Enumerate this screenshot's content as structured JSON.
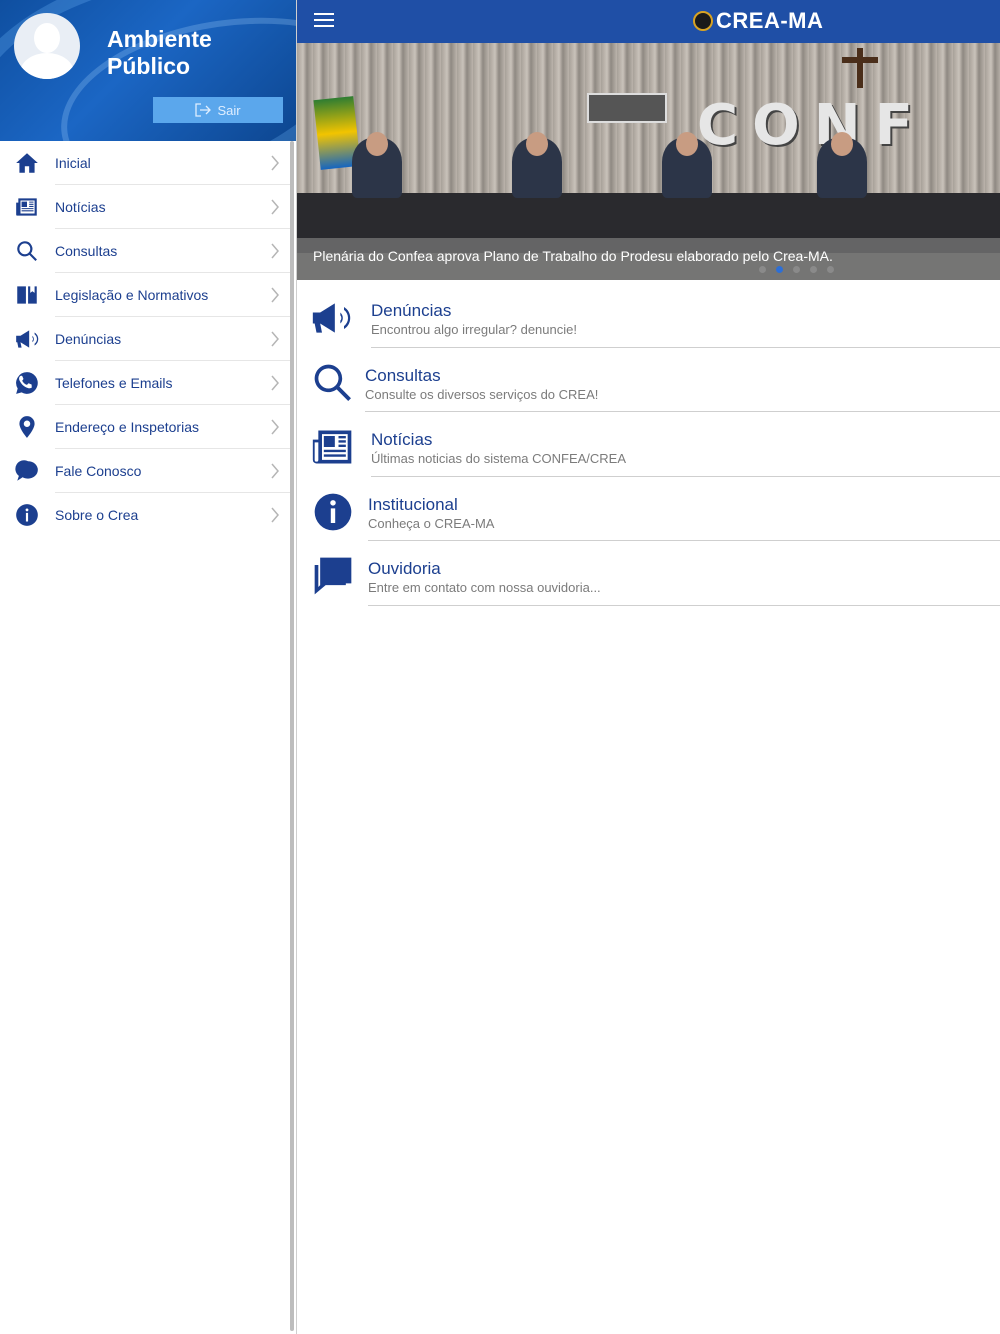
{
  "sidebar": {
    "title": "Ambiente Público",
    "logout_label": "Sair",
    "items": [
      {
        "label": "Inicial",
        "icon": "home-icon"
      },
      {
        "label": "Notícias",
        "icon": "newspaper-icon"
      },
      {
        "label": "Consultas",
        "icon": "search-icon"
      },
      {
        "label": "Legislação e Normativos",
        "icon": "book-icon"
      },
      {
        "label": "Denúncias",
        "icon": "megaphone-icon"
      },
      {
        "label": "Telefones e Emails",
        "icon": "whatsapp-icon"
      },
      {
        "label": "Endereço e Inspetorias",
        "icon": "location-pin-icon"
      },
      {
        "label": "Fale Conosco",
        "icon": "chat-bubble-icon"
      },
      {
        "label": "Sobre o Crea",
        "icon": "info-icon"
      }
    ]
  },
  "header": {
    "brand": "CREA-MA"
  },
  "banner": {
    "caption": "Plenária do Confea aprova Plano de Trabalho do Prodesu elaborado pelo Crea-MA.",
    "wall_text": "CONF",
    "slides": 5,
    "active_slide": 2
  },
  "features": [
    {
      "title": "Denúncias",
      "subtitle": "Encontrou algo irregular? denuncie!",
      "icon": "megaphone-icon"
    },
    {
      "title": "Consultas",
      "subtitle": "Consulte os diversos serviços do CREA!",
      "icon": "search-icon"
    },
    {
      "title": "Notícias",
      "subtitle": "Últimas noticias do sistema CONFEA/CREA",
      "icon": "newspaper-icon"
    },
    {
      "title": "Institucional",
      "subtitle": "Conheça o CREA-MA",
      "icon": "info-icon"
    },
    {
      "title": "Ouvidoria",
      "subtitle": "Entre em contato com nossa ouvidoria...",
      "icon": "chat-bubble-icon"
    }
  ],
  "colors": {
    "primary": "#1f4fa6",
    "text_blue": "#1c3f8f",
    "logout_button": "#5ba7ec",
    "subtitle_gray": "#7b7b7b"
  }
}
